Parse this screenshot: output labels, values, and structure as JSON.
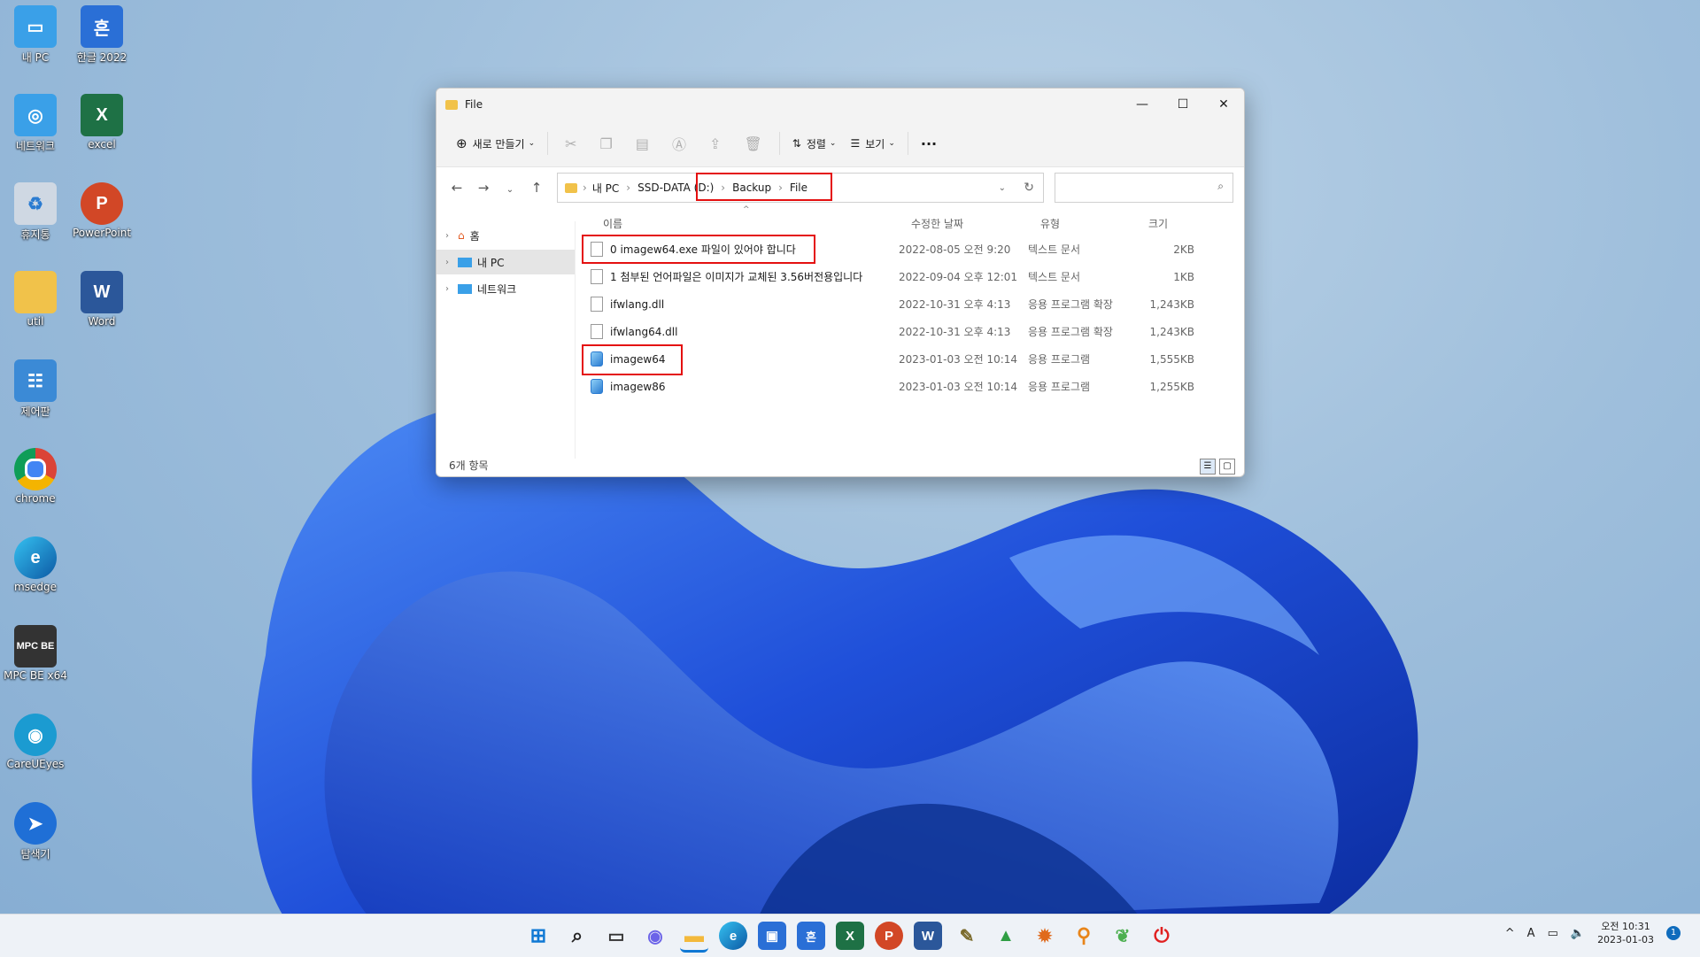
{
  "desktop_icons": [
    {
      "label": "내 PC",
      "icon": "monitor-icon",
      "color": "#3aa0e8"
    },
    {
      "label": "한글 2022",
      "icon": "hangul-icon",
      "color": "#2a6fd6",
      "glyph": "흔"
    },
    {
      "label": "네트워크",
      "icon": "network-icon",
      "color": "#3aa0e8"
    },
    {
      "label": "excel",
      "icon": "excel-icon",
      "color": "#1e7145",
      "glyph": "X"
    },
    {
      "label": "휴지통",
      "icon": "recycle-bin-icon",
      "color": "#cfd8e3",
      "glyph": "♻"
    },
    {
      "label": "PowerPoint",
      "icon": "powerpoint-icon",
      "color": "#d24726",
      "glyph": "P"
    },
    {
      "label": "util",
      "icon": "folder-icon",
      "color": "#f1c24a"
    },
    {
      "label": "Word",
      "icon": "word-icon",
      "color": "#2b579a",
      "glyph": "W"
    },
    {
      "label": "제어판",
      "icon": "control-panel-icon",
      "color": "#3b8ad6"
    },
    {
      "label": "chrome",
      "icon": "chrome-icon",
      "color": "#db4437"
    },
    {
      "label": "msedge",
      "icon": "edge-icon",
      "color": "#0c84d6"
    },
    {
      "label": "MPC BE x64",
      "icon": "mpc-be-icon",
      "color": "#333333",
      "glyph": "MPC BE"
    },
    {
      "label": "CareUEyes",
      "icon": "eye-icon",
      "color": "#1b9bd1"
    },
    {
      "label": "탐색기",
      "icon": "bolt-icon",
      "color": "#1f6fd6"
    }
  ],
  "window": {
    "title": "File",
    "commands": {
      "new": "새로 만들기",
      "sort": "정렬",
      "view": "보기",
      "more": "···"
    },
    "breadcrumb": [
      "내 PC",
      "SSD-DATA (D:)",
      "Backup",
      "File"
    ],
    "search_placeholder": "",
    "nav": [
      {
        "label": "홈",
        "icon": "home-icon"
      },
      {
        "label": "내 PC",
        "icon": "pc-icon"
      },
      {
        "label": "네트워크",
        "icon": "network-icon"
      }
    ],
    "columns": {
      "name": "이름",
      "modified": "수정한 날짜",
      "type": "유형",
      "size": "크기"
    },
    "files": [
      {
        "name": "0 imagew64.exe 파일이 있어야 합니다",
        "modified": "2022-08-05 오전 9:20",
        "type": "텍스트 문서",
        "size": "2KB",
        "kind": "doc"
      },
      {
        "name": "1 첨부된 언어파일은 이미지가 교체된 3.56버전용입니다",
        "modified": "2022-09-04 오후 12:01",
        "type": "텍스트 문서",
        "size": "1KB",
        "kind": "doc"
      },
      {
        "name": "ifwlang.dll",
        "modified": "2022-10-31 오후 4:13",
        "type": "응용 프로그램 확장",
        "size": "1,243KB",
        "kind": "doc"
      },
      {
        "name": "ifwlang64.dll",
        "modified": "2022-10-31 오후 4:13",
        "type": "응용 프로그램 확장",
        "size": "1,243KB",
        "kind": "doc"
      },
      {
        "name": "imagew64",
        "modified": "2023-01-03 오전 10:14",
        "type": "응용 프로그램",
        "size": "1,555KB",
        "kind": "app"
      },
      {
        "name": "imagew86",
        "modified": "2023-01-03 오전 10:14",
        "type": "응용 프로그램",
        "size": "1,255KB",
        "kind": "app"
      }
    ],
    "status": "6개 항목"
  },
  "taskbar": {
    "apps": [
      {
        "icon": "start-icon",
        "color": "#0f78d4",
        "glyph": "⊞"
      },
      {
        "icon": "search-icon",
        "color": "#222222",
        "glyph": "⌕"
      },
      {
        "icon": "task-view-icon",
        "color": "#333333",
        "glyph": "▭"
      },
      {
        "icon": "chat-icon",
        "color": "#6b63e8",
        "glyph": "◉"
      },
      {
        "icon": "file-explorer-icon",
        "color": "#f3b93c",
        "glyph": "▬"
      },
      {
        "icon": "edge-icon",
        "color": "#0c84d6",
        "glyph": "e"
      },
      {
        "icon": "store-icon",
        "color": "#2a6fd6",
        "glyph": "▣"
      },
      {
        "icon": "hangul-icon",
        "color": "#2a6fd6",
        "glyph": "흔"
      },
      {
        "icon": "excel-icon",
        "color": "#1e7145",
        "glyph": "X"
      },
      {
        "icon": "powerpoint-icon",
        "color": "#d24726",
        "glyph": "P"
      },
      {
        "icon": "word-icon",
        "color": "#2b579a",
        "glyph": "W"
      },
      {
        "icon": "tool-icon",
        "color": "#7a6a2a",
        "glyph": "✎"
      },
      {
        "icon": "triangle-app-icon",
        "color": "#2f9e44",
        "glyph": "▲"
      },
      {
        "icon": "settings-app-icon",
        "color": "#e06a1c",
        "glyph": "✹"
      },
      {
        "icon": "magnifier-icon",
        "color": "#e8851a",
        "glyph": "⚲"
      },
      {
        "icon": "leaf-icon",
        "color": "#4caf50",
        "glyph": "❦"
      },
      {
        "icon": "power-icon",
        "color": "#e02020",
        "glyph": "⏻"
      }
    ],
    "tray": {
      "ime": "A",
      "time": "오전 10:31",
      "date": "2023-01-03",
      "notifications": "1"
    }
  }
}
